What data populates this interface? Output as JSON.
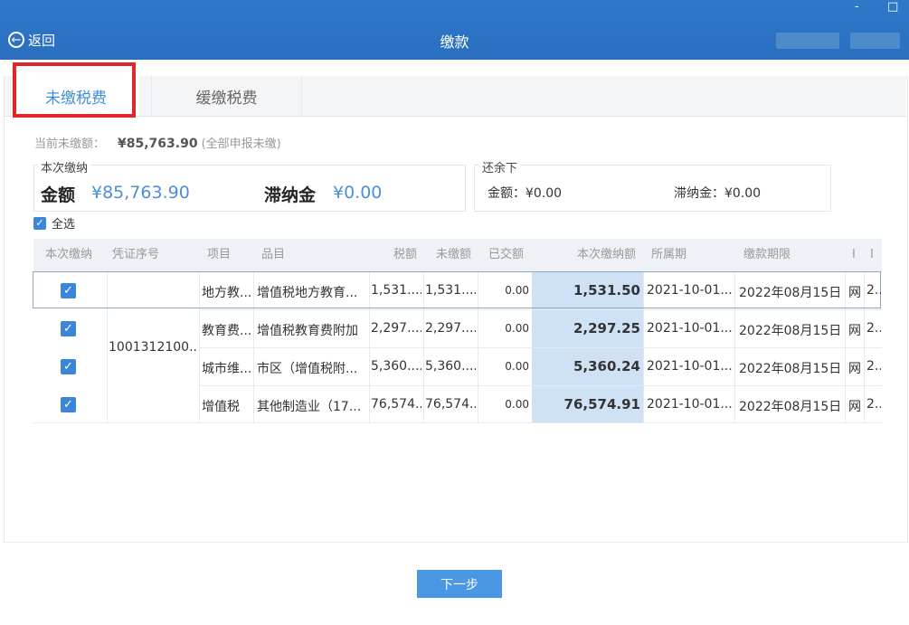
{
  "window": {
    "controls": [
      "-",
      "□"
    ]
  },
  "header": {
    "back_label": "返回",
    "title": "缴款"
  },
  "tabs": [
    {
      "label": "未缴税费"
    },
    {
      "label": "缓缴税费"
    }
  ],
  "summary": {
    "label": "当前未缴额：",
    "amount": "¥85,763.90",
    "note": "(全部申报未缴)"
  },
  "this_payment": {
    "legend": "本次缴纳",
    "amount_label": "金额",
    "amount_value": "¥85,763.90",
    "late_fee_label": "滞纳金",
    "late_fee_value": "¥0.00"
  },
  "remaining": {
    "legend": "还余下",
    "amount_text": "金额：¥0.00",
    "late_fee_text": "滞纳金：¥0.00"
  },
  "select_all_label": "全选",
  "table": {
    "headers": [
      "本次缴纳",
      "凭证序号",
      "项目",
      "品目",
      "税额",
      "未缴额",
      "已交额",
      "本次缴纳额",
      "所属期",
      "缴款期限",
      "I",
      "I"
    ],
    "voucher": "1001312100...",
    "rows": [
      {
        "checked": true,
        "item": "地方教...",
        "subitem": "增值税地方教育...",
        "tax": "1,531....",
        "unpaid": "1,531....",
        "paid": "0.00",
        "pay_now": "1,531.50",
        "period": "2021-10-01...",
        "deadline": "2022年08月15日",
        "c1": "网",
        "c2": "2.."
      },
      {
        "checked": true,
        "item": "教育费...",
        "subitem": "增值税教育费附加",
        "tax": "2,297....",
        "unpaid": "2,297....",
        "paid": "0.00",
        "pay_now": "2,297.25",
        "period": "2021-10-01...",
        "deadline": "2022年08月15日",
        "c1": "网",
        "c2": "2.."
      },
      {
        "checked": true,
        "item": "城市维...",
        "subitem": "市区（增值税附...",
        "tax": "5,360....",
        "unpaid": "5,360....",
        "paid": "0.00",
        "pay_now": "5,360.24",
        "period": "2021-10-01...",
        "deadline": "2022年08月15日",
        "c1": "网",
        "c2": "2.."
      },
      {
        "checked": true,
        "item": "增值税",
        "subitem": "其他制造业（17...",
        "tax": "76,574....",
        "unpaid": "76,574....",
        "paid": "0.00",
        "pay_now": "76,574.91",
        "period": "2021-10-01...",
        "deadline": "2022年08月15日",
        "c1": "网",
        "c2": "2.."
      }
    ]
  },
  "next_button": "下一步",
  "colors": {
    "header_blue": "#2a6fbf",
    "accent": "#3f8fd8",
    "highlight": "#e0252b",
    "column_highlight": "#cfe1f5"
  }
}
